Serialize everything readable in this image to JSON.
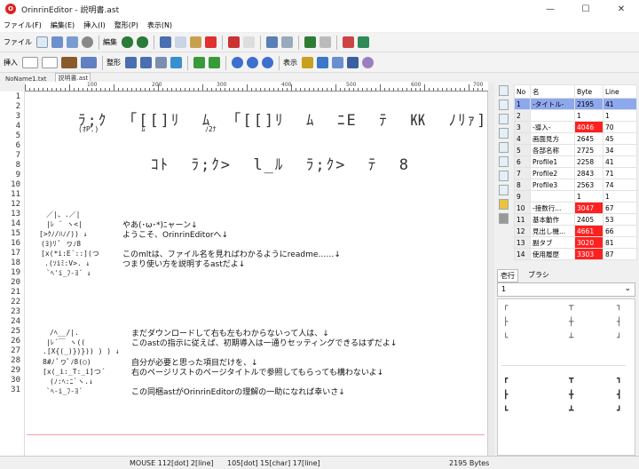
{
  "window": {
    "title": "OrinrinEditor - 説明書.ast",
    "app_icon": "orinrin-logo-icon",
    "minimize": "—",
    "maximize": "☐",
    "close": "✕"
  },
  "menu": [
    "ファイル(F)",
    "編集(E)",
    "挿入(I)",
    "整形(P)",
    "表示(N)"
  ],
  "toolbar1": {
    "file_label": "ファイル",
    "edit_label": "編集"
  },
  "toolbar2": {
    "insert_label": "挿入",
    "format_label": "整形",
    "view_label": "表示"
  },
  "doc_tabs": [
    "NoName1.txt",
    "説明書.ast"
  ],
  "ruler": {
    "labels": [
      "100",
      "200",
      "300",
      "400",
      "500",
      "600",
      "700"
    ]
  },
  "line_numbers": [
    "1",
    "2",
    "3",
    "4",
    "5",
    "6",
    "7",
    "8",
    "9",
    "10",
    "11",
    "12",
    "13",
    "14",
    "15",
    "16",
    "17",
    "18",
    "19",
    "20",
    "21",
    "22",
    "23",
    "24",
    "25",
    "26",
    "27",
    "28",
    "29",
    "30",
    "31"
  ],
  "editor": {
    "title_row1": "ﾗ;ｸ  ｢[[]ﾘ  ﾑ  ｢[[]ﾘ  ﾑ  ﾆE  ﾃ  ㏍  ﾉﾘｧ]",
    "title_row1b": "(ｵP.)          ﾑ              ﾉ2ﾅ",
    "title_row2": "ｺﾄ  ﾗ;ｸ>  l_ﾙ  ﾗ;ｸ>  ﾃ  8",
    "aa1": [
      "／|、.／|",
      "|ﾚ ¨ ヽ<|",
      "[>ｸﾉ/ﾊﾉ/)) ↓",
      "(ﾖ)ﾘ ﾟ ヮﾉ8",
      "[x(*i:E´::](つ",
      ".(ｿiﾐ:V>. ↓",
      "`ﾍ'i_ﾌ-ﾖ´ ↓"
    ],
    "l12": "やあ(･ω･*)ﾆャーン↓",
    "l13": "ようこそ、OrinrinEditorへ↓",
    "l15": "このmltは、ファイル名を見ればわかるようにreadme……↓",
    "l16": "つまり使い方を説明するastだよ↓",
    "aa2": [
      "/ﾍ__/|.",
      "|ﾚ´￣ ヽ((",
      ".[X{(_)})})) ) ) ↓",
      "8#ﾉ ﾟヮﾟﾉ8(○)",
      "[x(_i:_T:_i]つ´",
      "(ﾉ:ﾍ:ﾆ`ヽ.↓",
      "`ﾍ-i_ﾌ-ﾖ´"
    ],
    "l22": "まだダウンロードして右も左もわからないって人は、↓",
    "l23": "このastの指示に従えば、初期導入は一通りセッティングできるはずだよ↓",
    "l25": "自分が必要と思った項目だけを、↓",
    "l26": "右のページリストのページタイトルで参照してもらっても構わないよ↓",
    "l28": "この同梱astがOrinrinEditorの理解の一助になれば幸いさ↓"
  },
  "page_list": {
    "headers": [
      "No",
      "名",
      "Byte",
      "Line"
    ],
    "rows": [
      {
        "no": "1",
        "name": "-タイトル-",
        "byte": "2195",
        "line": "41",
        "style": "sel"
      },
      {
        "no": "2",
        "name": "",
        "byte": "1",
        "line": "1",
        "style": ""
      },
      {
        "no": "3",
        "name": "-導入-",
        "byte": "4046",
        "line": "70",
        "style": "red"
      },
      {
        "no": "4",
        "name": "画面見方",
        "byte": "2645",
        "line": "45",
        "style": ""
      },
      {
        "no": "5",
        "name": "各部名称",
        "byte": "2725",
        "line": "34",
        "style": ""
      },
      {
        "no": "6",
        "name": "Profile1",
        "byte": "2258",
        "line": "41",
        "style": ""
      },
      {
        "no": "7",
        "name": "Profile2",
        "byte": "2843",
        "line": "71",
        "style": ""
      },
      {
        "no": "8",
        "name": "Profile3",
        "byte": "2563",
        "line": "74",
        "style": ""
      },
      {
        "no": "9",
        "name": "",
        "byte": "1",
        "line": "1",
        "style": ""
      },
      {
        "no": "10",
        "name": "-接数行...",
        "byte": "3047",
        "line": "67",
        "style": "red"
      },
      {
        "no": "11",
        "name": "基本動作",
        "byte": "2405",
        "line": "53",
        "style": ""
      },
      {
        "no": "12",
        "name": "見出し機...",
        "byte": "4661",
        "line": "66",
        "style": "red"
      },
      {
        "no": "13",
        "name": "副タブ",
        "byte": "3020",
        "line": "81",
        "style": "red"
      },
      {
        "no": "14",
        "name": "使用履歴",
        "byte": "3303",
        "line": "87",
        "style": "red"
      }
    ]
  },
  "side_tabs": [
    "壱行",
    "ブラシ"
  ],
  "parts_select": "1",
  "status": {
    "mouse": "MOUSE 112[dot] 2[line]",
    "cursor": "105[dot] 15[char] 17[line]",
    "bytes": "2195 Bytes"
  },
  "colors": {
    "selected_row": "#8ea8ee",
    "over_limit": "#ff2020",
    "page_break": "#f4a0a0",
    "eol_mark": "#2a9a8a"
  }
}
